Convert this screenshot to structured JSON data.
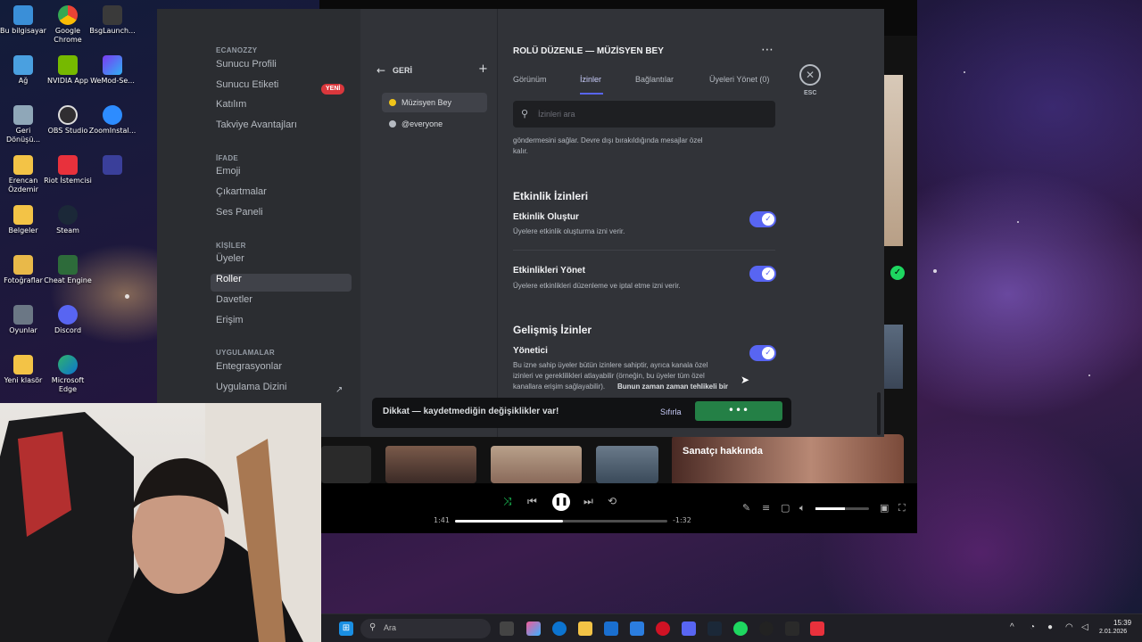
{
  "desktop": {
    "icons_col1": [
      "Bu bilgisayar",
      "Ağ",
      "Geri Dönüşü...",
      "Erencan Özdemir",
      "Belgeler",
      "Fotoğraflar",
      "Oyunlar",
      "Yeni klasör"
    ],
    "icons_col2": [
      "Google Chrome",
      "NVIDIA App",
      "OBS Studio",
      "Riot İstemcisi",
      "Steam",
      "Cheat Engine",
      "Discord",
      "Microsoft Edge"
    ],
    "icons_col3": [
      "BsgLaunch...",
      "WeMod-Se...",
      "ZoomInstal...",
      ""
    ]
  },
  "discord": {
    "server_name": "ECANOZZY",
    "sections": [
      {
        "title": "",
        "items": [
          "Sunucu Profili",
          "Sunucu Etiketi",
          "Katılım",
          "Takviye Avantajları"
        ]
      },
      {
        "title": "İFADE",
        "items": [
          "Emoji",
          "Çıkartmalar",
          "Ses Paneli"
        ]
      },
      {
        "title": "KİŞİLER",
        "items": [
          "Üyeler",
          "Roller",
          "Davetler",
          "Erişim"
        ]
      },
      {
        "title": "UYGULAMALAR",
        "items": [
          "Entegrasyonlar",
          "Uygulama Dizini"
        ]
      }
    ],
    "new_badge": "YENİ",
    "back_label": "GERİ",
    "roles": [
      {
        "name": "Müzisyen Bey",
        "color": "#f0c419"
      },
      {
        "name": "@everyone",
        "color": "#b5bac1"
      }
    ],
    "header_title": "ROLÜ DÜZENLE — MÜZİSYEN BEY",
    "tabs": [
      "Görünüm",
      "İzinler",
      "Bağlantılar",
      "Üyeleri Yönet (0)"
    ],
    "search_placeholder": "İzinleri ara",
    "truncated_desc_1": "göndermesini sağlar. Devre dışı bırakıldığında mesajlar özel",
    "truncated_desc_2": "kalır.",
    "event_section": "Etkinlik İzinleri",
    "perm1_name": "Etkinlik Oluştur",
    "perm1_desc": "Üyelere etkinlik oluşturma izni verir.",
    "perm2_name": "Etkinlikleri Yönet",
    "perm2_desc": "Üyelere etkinlikleri düzenleme ve iptal etme izni verir.",
    "advanced_section": "Gelişmiş İzinler",
    "perm3_name": "Yönetici",
    "perm3_desc_1": "Bu izne sahip üyeler bütün izinlere sahiptir, ayrıca kanala özel",
    "perm3_desc_2": "izinleri ve gereklilikleri atlayabilir (örneğin, bu üyeler tüm özel",
    "perm3_desc_3": "kanallara erişim sağlayabilir).",
    "perm3_desc_bold": "Bunun zaman zaman tehlikeli bir",
    "esc_label": "ESC",
    "unsaved_msg": "Dikkat — kaydetmediğin değişiklikler var!",
    "reset_label": "Sıfırla",
    "accent": "#5865f2"
  },
  "spotify": {
    "artist_label": "Sanatçı hakkında",
    "elapsed": "1:41",
    "remaining": "-1:32",
    "progress": 0.51,
    "volume": 0.55
  },
  "taskbar": {
    "search_placeholder": "Ara",
    "time": "15:39",
    "date": "2.01.2026"
  }
}
